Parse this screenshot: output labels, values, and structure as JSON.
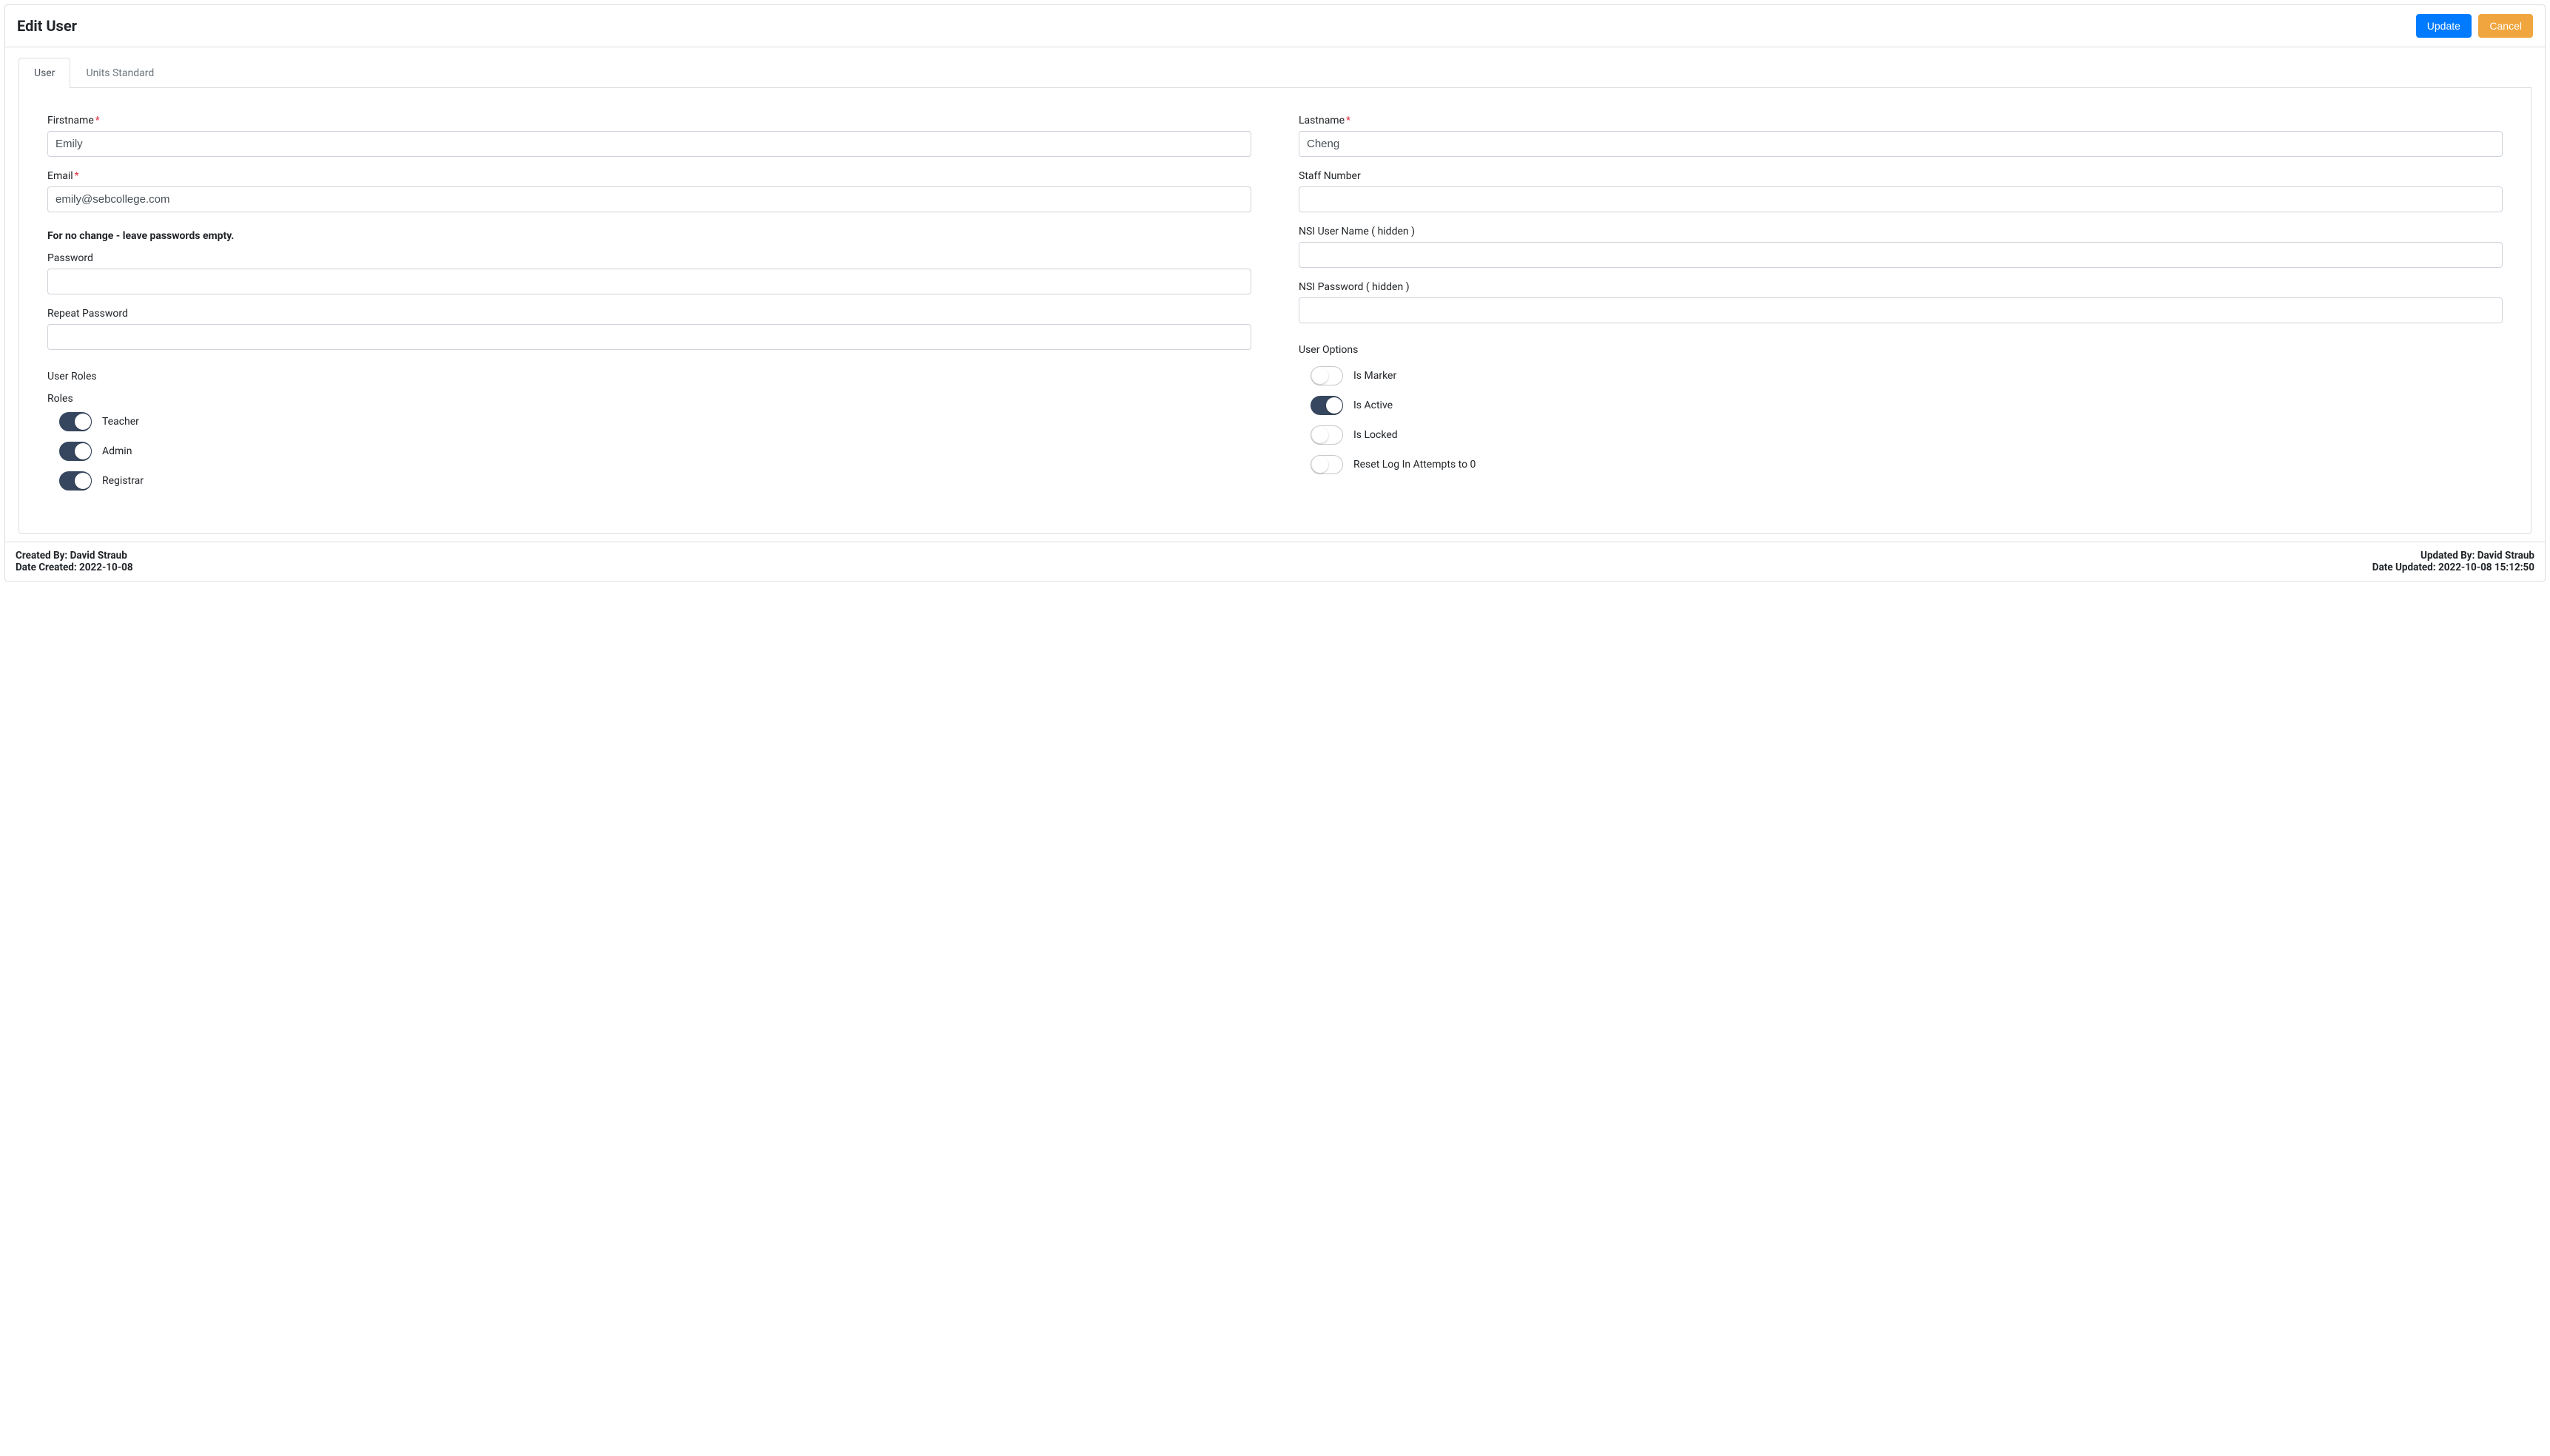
{
  "header": {
    "title": "Edit User",
    "update_label": "Update",
    "cancel_label": "Cancel"
  },
  "tabs": {
    "user": "User",
    "units_standard": "Units Standard"
  },
  "left": {
    "firstname_label": "Firstname",
    "firstname_value": "Emily",
    "email_label": "Email",
    "email_value": "emily@sebcollege.com",
    "pw_note": "For no change - leave passwords empty.",
    "password_label": "Password",
    "password_value": "",
    "repeat_password_label": "Repeat Password",
    "repeat_password_value": "",
    "user_roles_section": "User Roles",
    "roles_label": "Roles",
    "roles": {
      "teacher": "Teacher",
      "admin": "Admin",
      "registrar": "Registrar"
    }
  },
  "right": {
    "lastname_label": "Lastname",
    "lastname_value": "Cheng",
    "staff_number_label": "Staff Number",
    "staff_number_value": "",
    "nsi_user_label": "NSI User Name ( hidden )",
    "nsi_user_value": "",
    "nsi_password_label": "NSI Password ( hidden )",
    "nsi_password_value": "",
    "user_options_section": "User Options",
    "options": {
      "is_marker": "Is Marker",
      "is_active": "Is Active",
      "is_locked": "Is Locked",
      "reset_attempts": "Reset Log In Attempts to 0"
    }
  },
  "footer": {
    "created_by_label": "Created By: ",
    "created_by_value": "David Straub",
    "date_created_label": "Date Created: ",
    "date_created_value": "2022-10-08",
    "updated_by_label": "Updated By: ",
    "updated_by_value": "David Straub",
    "date_updated_label": "Date Updated: ",
    "date_updated_value": "2022-10-08 15:12:50"
  },
  "state": {
    "roles": {
      "teacher": true,
      "admin": true,
      "registrar": true
    },
    "options": {
      "is_marker": false,
      "is_active": true,
      "is_locked": false,
      "reset_attempts": false
    }
  }
}
